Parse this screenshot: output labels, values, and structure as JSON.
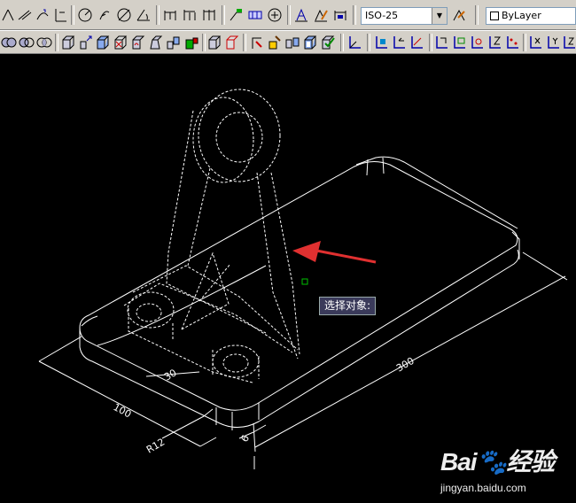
{
  "toolbar": {
    "dimstyle": "ISO-25",
    "layer": "ByLayer"
  },
  "cad": {
    "prompt": "选择对象:",
    "dims": {
      "d_300": "300",
      "d_100": "100",
      "d_30": "30",
      "d_r12": "R12",
      "d_6": "6"
    }
  },
  "watermark": {
    "logo": "Bai🐾经验",
    "url": "jingyan.baidu.com"
  },
  "icons": [
    "snap-icon",
    "dim-linear-icon",
    "dim-arc-icon",
    "dim-ordinate-icon",
    "dim-radius-icon",
    "dim-angular-icon",
    "union-icon",
    "subtract-icon",
    "box-icon",
    "ucs-icon",
    "arrow-annotation-icon"
  ],
  "colors": {
    "canvas": "#000000",
    "toolbar": "#d4d0c8",
    "line": "#ffffff",
    "arrow": "#e03030",
    "cursor": "#00c000"
  }
}
